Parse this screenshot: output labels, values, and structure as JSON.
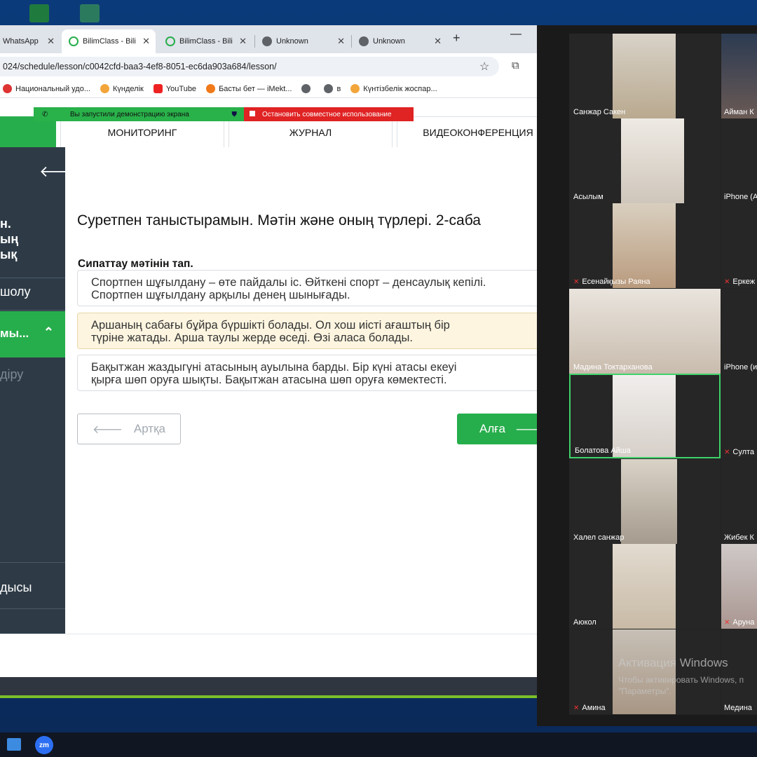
{
  "browser": {
    "tabs": [
      {
        "label": "WhatsApp",
        "icon": "whatsapp-icon"
      },
      {
        "label": "BilimClass - Bili",
        "icon": "bilimclass-icon"
      },
      {
        "label": "BilimClass - Bili",
        "icon": "bilimclass-icon"
      },
      {
        "label": "Unknown",
        "icon": "globe-icon"
      },
      {
        "label": "Unknown",
        "icon": "globe-icon"
      }
    ],
    "new_tab": "+",
    "minimize": "—",
    "url": "024/schedule/lesson/c0042cfd-baa3-4ef8-8051-ec6da903a684/lesson/",
    "bookmarks": [
      {
        "label": "Национальный удо...",
        "icon": "globe-icon"
      },
      {
        "label": "Күнделік",
        "icon": "kundelik-icon"
      },
      {
        "label": "YouTube",
        "icon": "youtube-icon"
      },
      {
        "label": "Басты бет — iMekt...",
        "icon": "imektep-icon"
      },
      {
        "label": "",
        "icon": "globe-icon"
      },
      {
        "label": "в",
        "icon": "globe-icon"
      },
      {
        "label": "Күнтізбелік жоспар...",
        "icon": "kundelik-icon"
      }
    ]
  },
  "screen_share": {
    "active_text": "Вы запустили демонстрацию экрана",
    "stop_text": "Остановить совместное использование"
  },
  "nav": {
    "tabs": [
      "МОНИТОРИНГ",
      "ЖУРНАЛ",
      "ВИДЕОКОНФЕРЕНЦИЯ"
    ]
  },
  "sidebar": {
    "course_title_lines": [
      "н.",
      "ың",
      "ық"
    ],
    "item1": "шолу",
    "active_item": "мы...",
    "sub_item": "діру",
    "bottom_item": "дысы"
  },
  "lesson": {
    "title": "Суретпен таныстырамын. Мәтін және оның түрлері. 2-саба",
    "question": "Сипаттау мәтінін тап.",
    "answers": [
      {
        "line1": "Спортпен шұғылдану – өте пайдалы іс. Өйткені спорт – денсаулық кепілі.",
        "line2": "Спортпен шұғылдану арқылы денең шынығады.",
        "selected": false
      },
      {
        "line1": "Аршаның сабағы бұйра бүршікті болады. Ол хош иісті ағаштың бір",
        "line2": "түріне жатады. Арша таулы жерде өседі. Өзі аласа болады.",
        "selected": true
      },
      {
        "line1": "Бақытжан жаздыгүні атасының ауылына барды. Бір күні атасы екеуі",
        "line2": "қырға шөп оруға шықты. Бақытжан атасына шөп оруға көмектесті.",
        "selected": false
      }
    ],
    "back_label": "Артқа",
    "next_label": "Алға"
  },
  "zoom": {
    "participants_left": [
      {
        "name": "Санжар Сакен",
        "muted": false
      },
      {
        "name": "Асылым",
        "muted": false
      },
      {
        "name": "Есенайқызы Раяна",
        "muted": true
      },
      {
        "name": "Мадина Токтарханова",
        "muted": false
      },
      {
        "name": "Болатова Айша",
        "muted": false,
        "speaking": true
      },
      {
        "name": "Халел санжар",
        "muted": false
      },
      {
        "name": "Аюкол",
        "muted": false
      },
      {
        "name": "Амина",
        "muted": true
      }
    ],
    "participants_right": [
      {
        "name": "Айман К",
        "muted": false
      },
      {
        "name": "iPhone (А",
        "muted": false
      },
      {
        "name": "Еркеж",
        "muted": true
      },
      {
        "name": "iPhone (и",
        "muted": false
      },
      {
        "name": "Султа",
        "muted": true
      },
      {
        "name": "Жибек К",
        "muted": false
      },
      {
        "name": "Аруна",
        "muted": true
      },
      {
        "name": "Медина",
        "muted": false
      }
    ]
  },
  "watermark": {
    "title": "Активация Windows",
    "line1": "Чтобы активировать Windows, п",
    "line2": "\"Параметры\"."
  },
  "taskbar": {
    "zoom_label": "zm"
  },
  "colors": {
    "brand_green": "#27ae4c",
    "sidebar_dark": "#2e3b47",
    "selected_answer_bg": "#fdf5e0",
    "stop_red": "#e02323"
  }
}
